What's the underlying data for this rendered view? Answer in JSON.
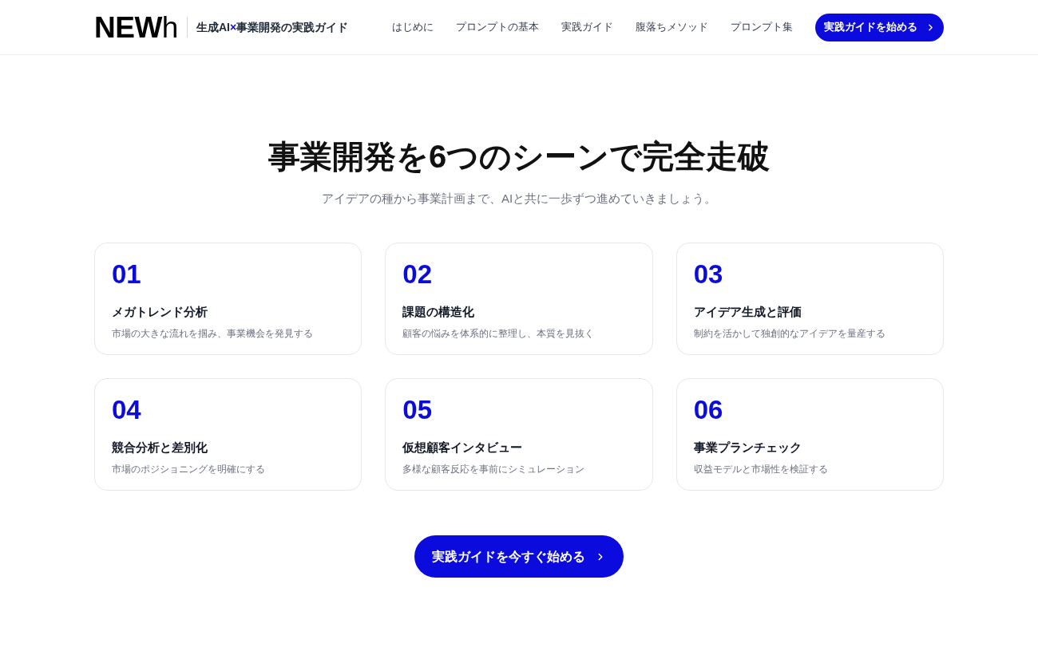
{
  "header": {
    "logo": {
      "strong": "NEW",
      "light": "h"
    },
    "site_title": [
      {
        "text": "生成AI",
        "accent": false
      },
      {
        "text": "×",
        "accent": true
      },
      {
        "text": "事業開発の実践ガイド",
        "accent": false
      }
    ],
    "nav": [
      "はじめに",
      "プロンプトの基本",
      "実践ガイド",
      "腹落ちメソッド",
      "プロンプト集"
    ],
    "cta": "実践ガイドを始める"
  },
  "section": {
    "title": "事業開発を6つのシーンで完全走破",
    "subtitle": "アイデアの種から事業計画まで、AIと共に一歩ずつ進めていきましょう。",
    "scenes": [
      {
        "number": "01",
        "title": "メガトレンド分析",
        "description": "市場の大きな流れを掴み、事業機会を発見する"
      },
      {
        "number": "02",
        "title": "課題の構造化",
        "description": "顧客の悩みを体系的に整理し、本質を見抜く"
      },
      {
        "number": "03",
        "title": "アイデア生成と評価",
        "description": "制約を活かして独創的なアイデアを量産する"
      },
      {
        "number": "04",
        "title": "競合分析と差別化",
        "description": "市場のポジショニングを明確にする"
      },
      {
        "number": "05",
        "title": "仮想顧客インタビュー",
        "description": "多様な顧客反応を事前にシミュレーション"
      },
      {
        "number": "06",
        "title": "事業プランチェック",
        "description": "収益モデルと市場性を検証する"
      }
    ],
    "cta": "実践ガイドを今すぐ始める"
  }
}
